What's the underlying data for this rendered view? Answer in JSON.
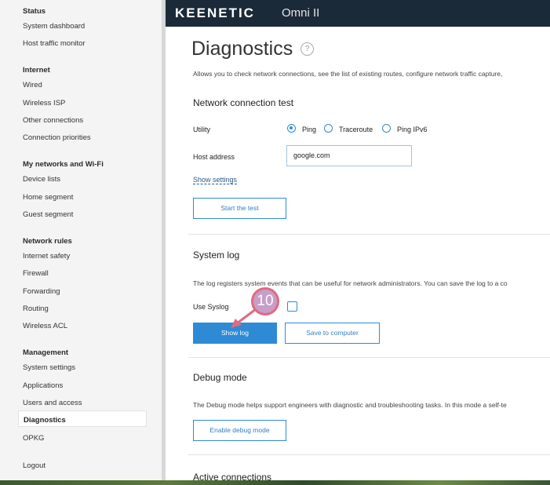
{
  "sidebar": {
    "sections": [
      {
        "title": "Status",
        "items": [
          "System dashboard",
          "Host traffic monitor"
        ]
      },
      {
        "title": "Internet",
        "items": [
          "Wired",
          "Wireless ISP",
          "Other connections",
          "Connection priorities"
        ]
      },
      {
        "title": "My networks and Wi-Fi",
        "items": [
          "Device lists",
          "Home segment",
          "Guest segment"
        ]
      },
      {
        "title": "Network rules",
        "items": [
          "Internet safety",
          "Firewall",
          "Forwarding",
          "Routing",
          "Wireless ACL"
        ]
      },
      {
        "title": "Management",
        "items": [
          "System settings",
          "Applications",
          "Users and access",
          "Diagnostics",
          "OPKG"
        ]
      }
    ],
    "logout": "Logout"
  },
  "header": {
    "brand": "KEENETIC",
    "model": "Omni II"
  },
  "page": {
    "title": "Diagnostics",
    "help_icon": "?",
    "description": "Allows you to check network connections, see the list of existing routes, configure network traffic capture,"
  },
  "connection_test": {
    "title": "Network connection test",
    "utility_label": "Utility",
    "options": [
      "Ping",
      "Traceroute",
      "Ping IPv6"
    ],
    "selected": "Ping",
    "host_label": "Host address",
    "host_value": "google.com",
    "show_settings": "Show settings",
    "start_button": "Start the test"
  },
  "system_log": {
    "title": "System log",
    "description": "The log registers system events that can be useful for network administrators. You can save the log to a co",
    "syslog_label": "Use Syslog",
    "show_log_button": "Show log",
    "save_button": "Save to computer"
  },
  "debug": {
    "title": "Debug mode",
    "description": "The Debug mode helps support engineers with diagnostic and troubleshooting tasks. In this mode a self-te",
    "enable_button": "Enable debug mode"
  },
  "active_connections": {
    "title": "Active connections"
  },
  "step_marker": "10",
  "colors": {
    "accent": "#2f8ad6",
    "header_bg": "#1b2a38",
    "marker_fill": "#c79ec8",
    "marker_ring": "#e06a7e"
  }
}
